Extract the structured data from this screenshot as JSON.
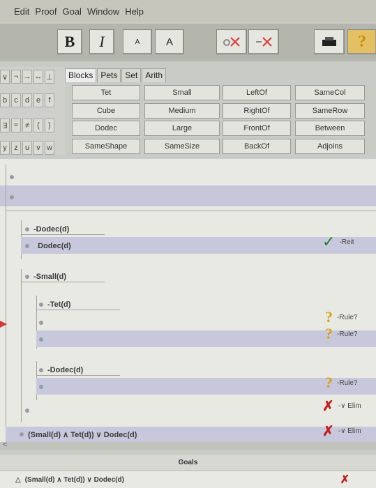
{
  "menu": [
    "Edit",
    "Proof",
    "Goal",
    "Window",
    "Help"
  ],
  "toolbar": {
    "bold": "B",
    "italic": "I",
    "small_a": "A",
    "large_a": "A"
  },
  "symbols": {
    "row1": [
      "∨",
      "¬",
      "→",
      "↔",
      "⊥"
    ],
    "row2": [
      "b",
      "c",
      "d",
      "e",
      "f"
    ],
    "row3": [
      "∃",
      "=",
      "≠",
      "(",
      ")"
    ],
    "row4": [
      "y",
      "z",
      "u",
      "v",
      "w"
    ]
  },
  "tabs": [
    "Blocks",
    "Pets",
    "Set",
    "Arith"
  ],
  "predicates": [
    [
      "Tet",
      "Small",
      "LeftOf",
      "SameCol"
    ],
    [
      "Cube",
      "Medium",
      "RightOf",
      "SameRow"
    ],
    [
      "Dodec",
      "Large",
      "FrontOf",
      "Between"
    ],
    [
      "SameShape",
      "SameSize",
      "BackOf",
      "Adjoins"
    ]
  ],
  "proof": {
    "line1": "Dodec(d)",
    "line2": "Dodec(d)",
    "line2_rule": "Reit",
    "line3": "Small(d)",
    "line4": "Tet(d)",
    "line5_rule": "Rule?",
    "line6_rule": "Rule?",
    "line7": "Dodec(d)",
    "line8_rule": "Rule?",
    "line9_rule": "∨ Elim",
    "line10": "(Small(d) ∧ Tet(d)) ∨ Dodec(d)",
    "line10_rule": "∨ Elim"
  },
  "goals": {
    "header": "Goals",
    "goal1": "(Small(d) ∧ Tet(d)) ∨ Dodec(d)"
  }
}
